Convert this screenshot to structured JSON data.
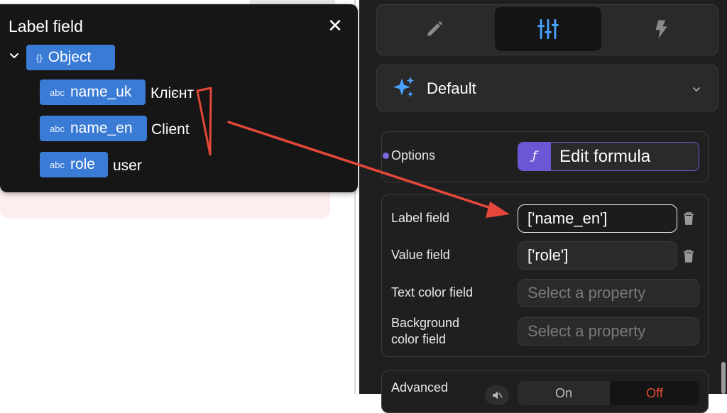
{
  "popup": {
    "title": "Label field",
    "root": {
      "type_icon": "{}",
      "label": "Object"
    },
    "rows": [
      {
        "type": "abc",
        "name": "name_uk",
        "value": "Клієнт"
      },
      {
        "type": "abc",
        "name": "name_en",
        "value": "Client"
      },
      {
        "type": "abc",
        "name": "role",
        "value": "user"
      }
    ]
  },
  "panel": {
    "tabs": [
      {
        "icon": "pencil-icon"
      },
      {
        "icon": "sliders-icon",
        "active": true
      },
      {
        "icon": "lightning-icon"
      }
    ],
    "preset": {
      "icon": "sparkles-icon",
      "label": "Default"
    },
    "options": {
      "label": "Options",
      "formula_label": "Edit formula",
      "formula_glyph": "ƒ"
    },
    "fields": {
      "label_field": {
        "label": "Label field",
        "value": "['name_en']"
      },
      "value_field": {
        "label": "Value field",
        "value": "['role']"
      },
      "text_color_field": {
        "label": "Text color field",
        "placeholder": "Select a property"
      },
      "background_color_field": {
        "label_line1": "Background",
        "label_line2": "color field",
        "placeholder": "Select a property"
      }
    },
    "advanced": {
      "label": "Advanced",
      "on_label": "On",
      "off_label": "Off"
    }
  },
  "colors": {
    "chip": "#3a7bd5",
    "accent_purple": "#6b57d6",
    "annotation_red": "#e5483a",
    "off_red": "#e5483a"
  }
}
